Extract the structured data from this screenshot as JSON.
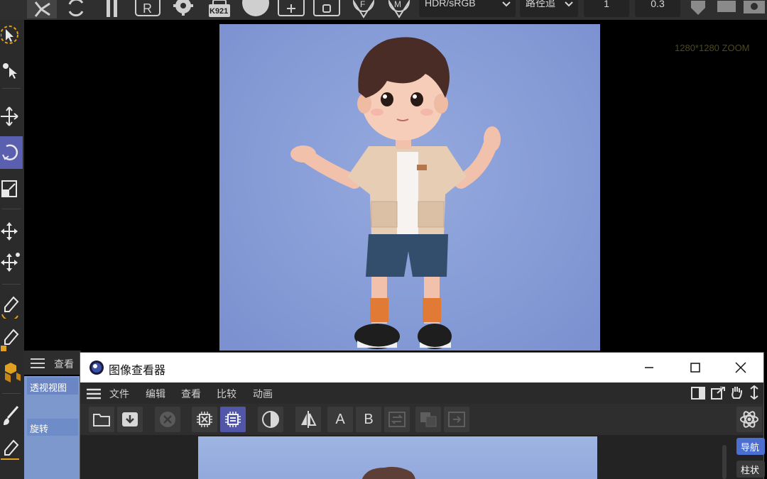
{
  "toolbar": {
    "render_key_label": "K921",
    "color_space": "HDR/sRGB",
    "path_mode": "路径追",
    "value_1": "1",
    "value_2": "0.3"
  },
  "viewport": {
    "zoom_info": "1280*1280 ZOOM"
  },
  "attribute_panel": {
    "title": "查看",
    "tab_1": "透视视图",
    "tab_2": "旋转"
  },
  "image_viewer": {
    "title": "图像查看器",
    "menu": [
      "文件",
      "编辑",
      "查看",
      "比较",
      "动画"
    ],
    "compare_a": "A",
    "compare_b": "B",
    "side_btn_1": "导航",
    "side_btn_2": "柱状"
  },
  "colors": {
    "accent": "#5a5fb0",
    "render_bg": "#859bd6",
    "side_btn_active": "#4b6fd0"
  }
}
